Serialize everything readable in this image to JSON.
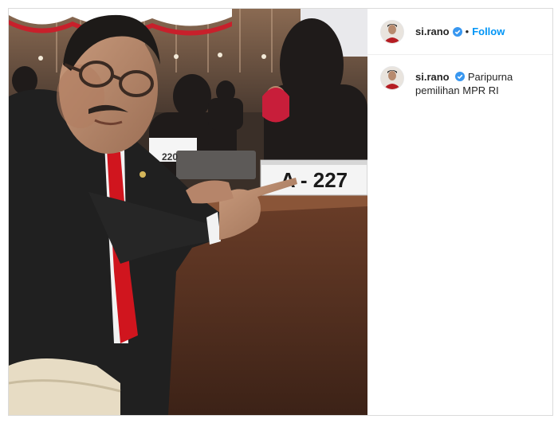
{
  "post": {
    "photo": {
      "alt": "",
      "nameplate_text": "A - 227",
      "background_nameplate_text": "220"
    },
    "author": {
      "username": "si.rano",
      "verified": true
    },
    "header": {
      "separator": "•",
      "follow_label": "Follow"
    },
    "caption": {
      "username": "si.rano",
      "text": "Paripurna pemilihan MPR RI"
    }
  },
  "colors": {
    "follow": "#0095f6",
    "verified_badge": "#3897f0",
    "text": "#262626",
    "divider": "#efefef"
  },
  "icons": {
    "verified": "verified-badge-icon",
    "avatar": "profile-avatar"
  }
}
